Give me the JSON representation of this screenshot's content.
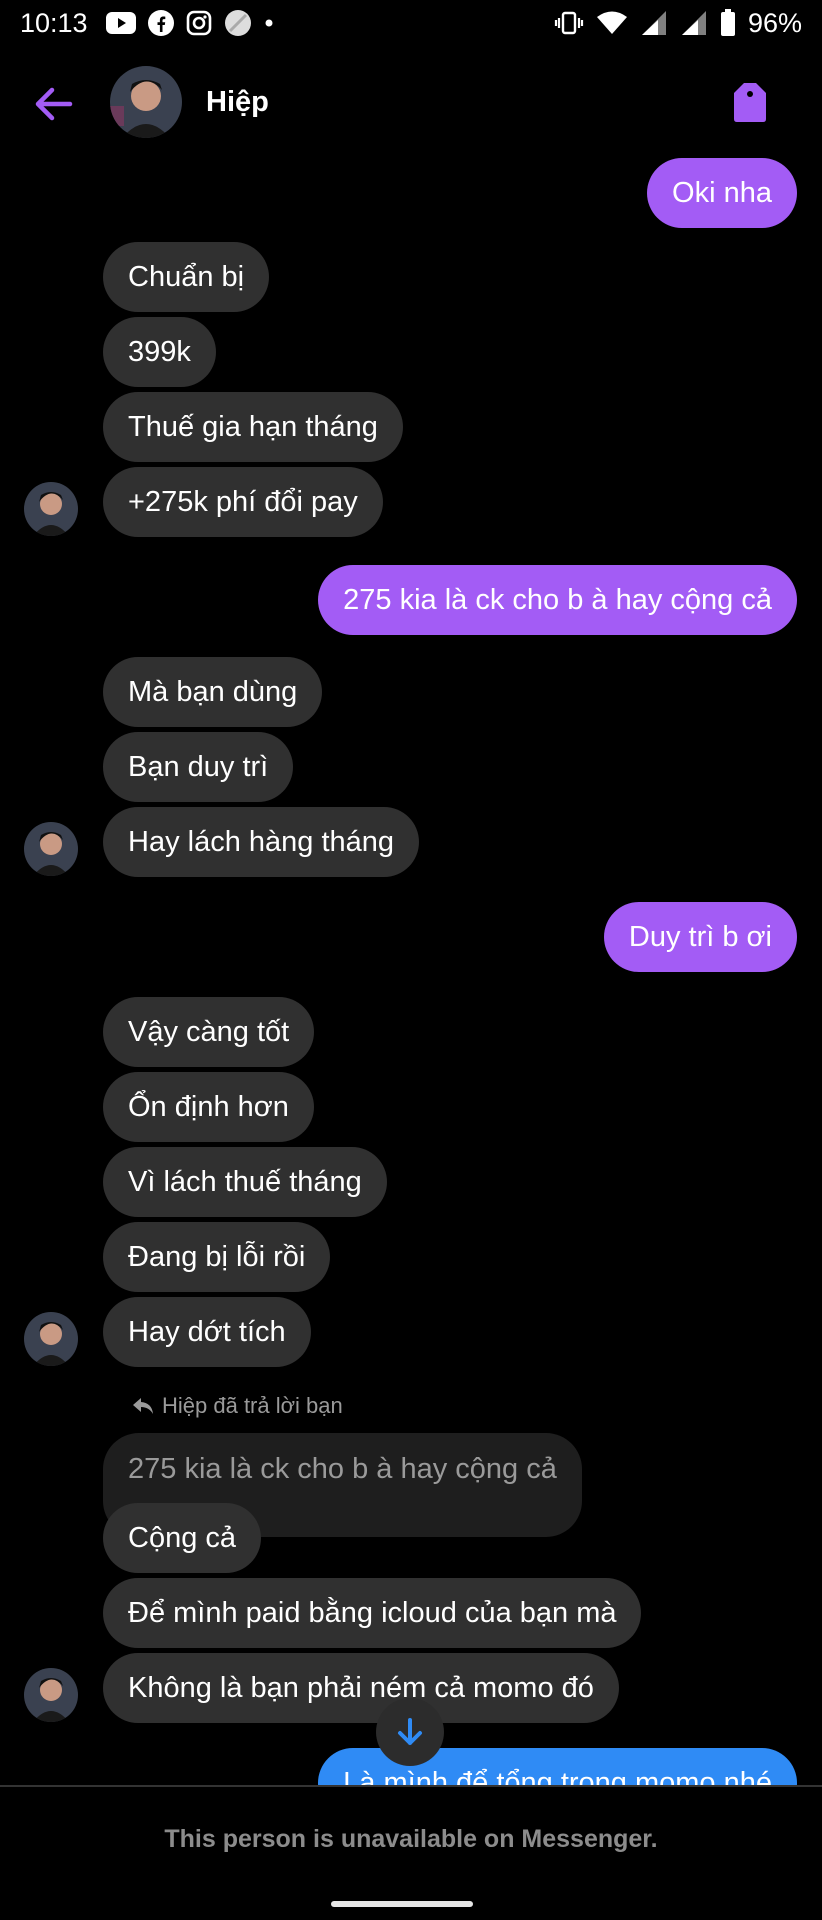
{
  "status_bar": {
    "time": "10:13",
    "battery": "96%",
    "icons_left": [
      "youtube-icon",
      "facebook-icon",
      "instagram-icon",
      "circle-app-icon",
      "dot-icon"
    ],
    "icons_right": [
      "vibrate-icon",
      "wifi-icon",
      "signal-icon",
      "signal-icon",
      "battery-icon"
    ]
  },
  "header": {
    "contact_name": "Hiệp",
    "back_icon": "arrow-left-icon",
    "action_icon": "tag-icon",
    "accent_color": "#a35cf5"
  },
  "messages": {
    "m1": "Oki nha",
    "m2": "Chuẩn bị",
    "m3": "399k",
    "m4": "Thuế gia hạn tháng",
    "m5": "+275k phí đổi pay",
    "m6": "275 kia là ck cho b à hay cộng cả",
    "m7": "Mà bạn dùng",
    "m8": "Bạn duy trì",
    "m9": "Hay lách hàng tháng",
    "m10": "Duy trì b ơi",
    "m11": "Vậy càng tốt",
    "m12": "Ổn định hơn",
    "m13": "Vì lách thuế tháng",
    "m14": "Đang bị lỗi rồi",
    "m15": "Hay dớt tích",
    "reply_note": "Hiệp đã trả lời bạn",
    "quoted": "275 kia là ck cho b à hay cộng cả",
    "m16": "Cộng cả",
    "m17": "Để mình paid bằng icloud của bạn mà",
    "m18": "Không là bạn phải ném cả momo đó",
    "m19": "Là mình để tổng trong momo nhé"
  },
  "footer": {
    "notice": "This person is unavailable on Messenger."
  },
  "colors": {
    "outgoing_bubble": "#a35cf5",
    "outgoing_bubble_latest": "#2f8bf5",
    "incoming_bubble": "#303030",
    "background": "#000000"
  }
}
